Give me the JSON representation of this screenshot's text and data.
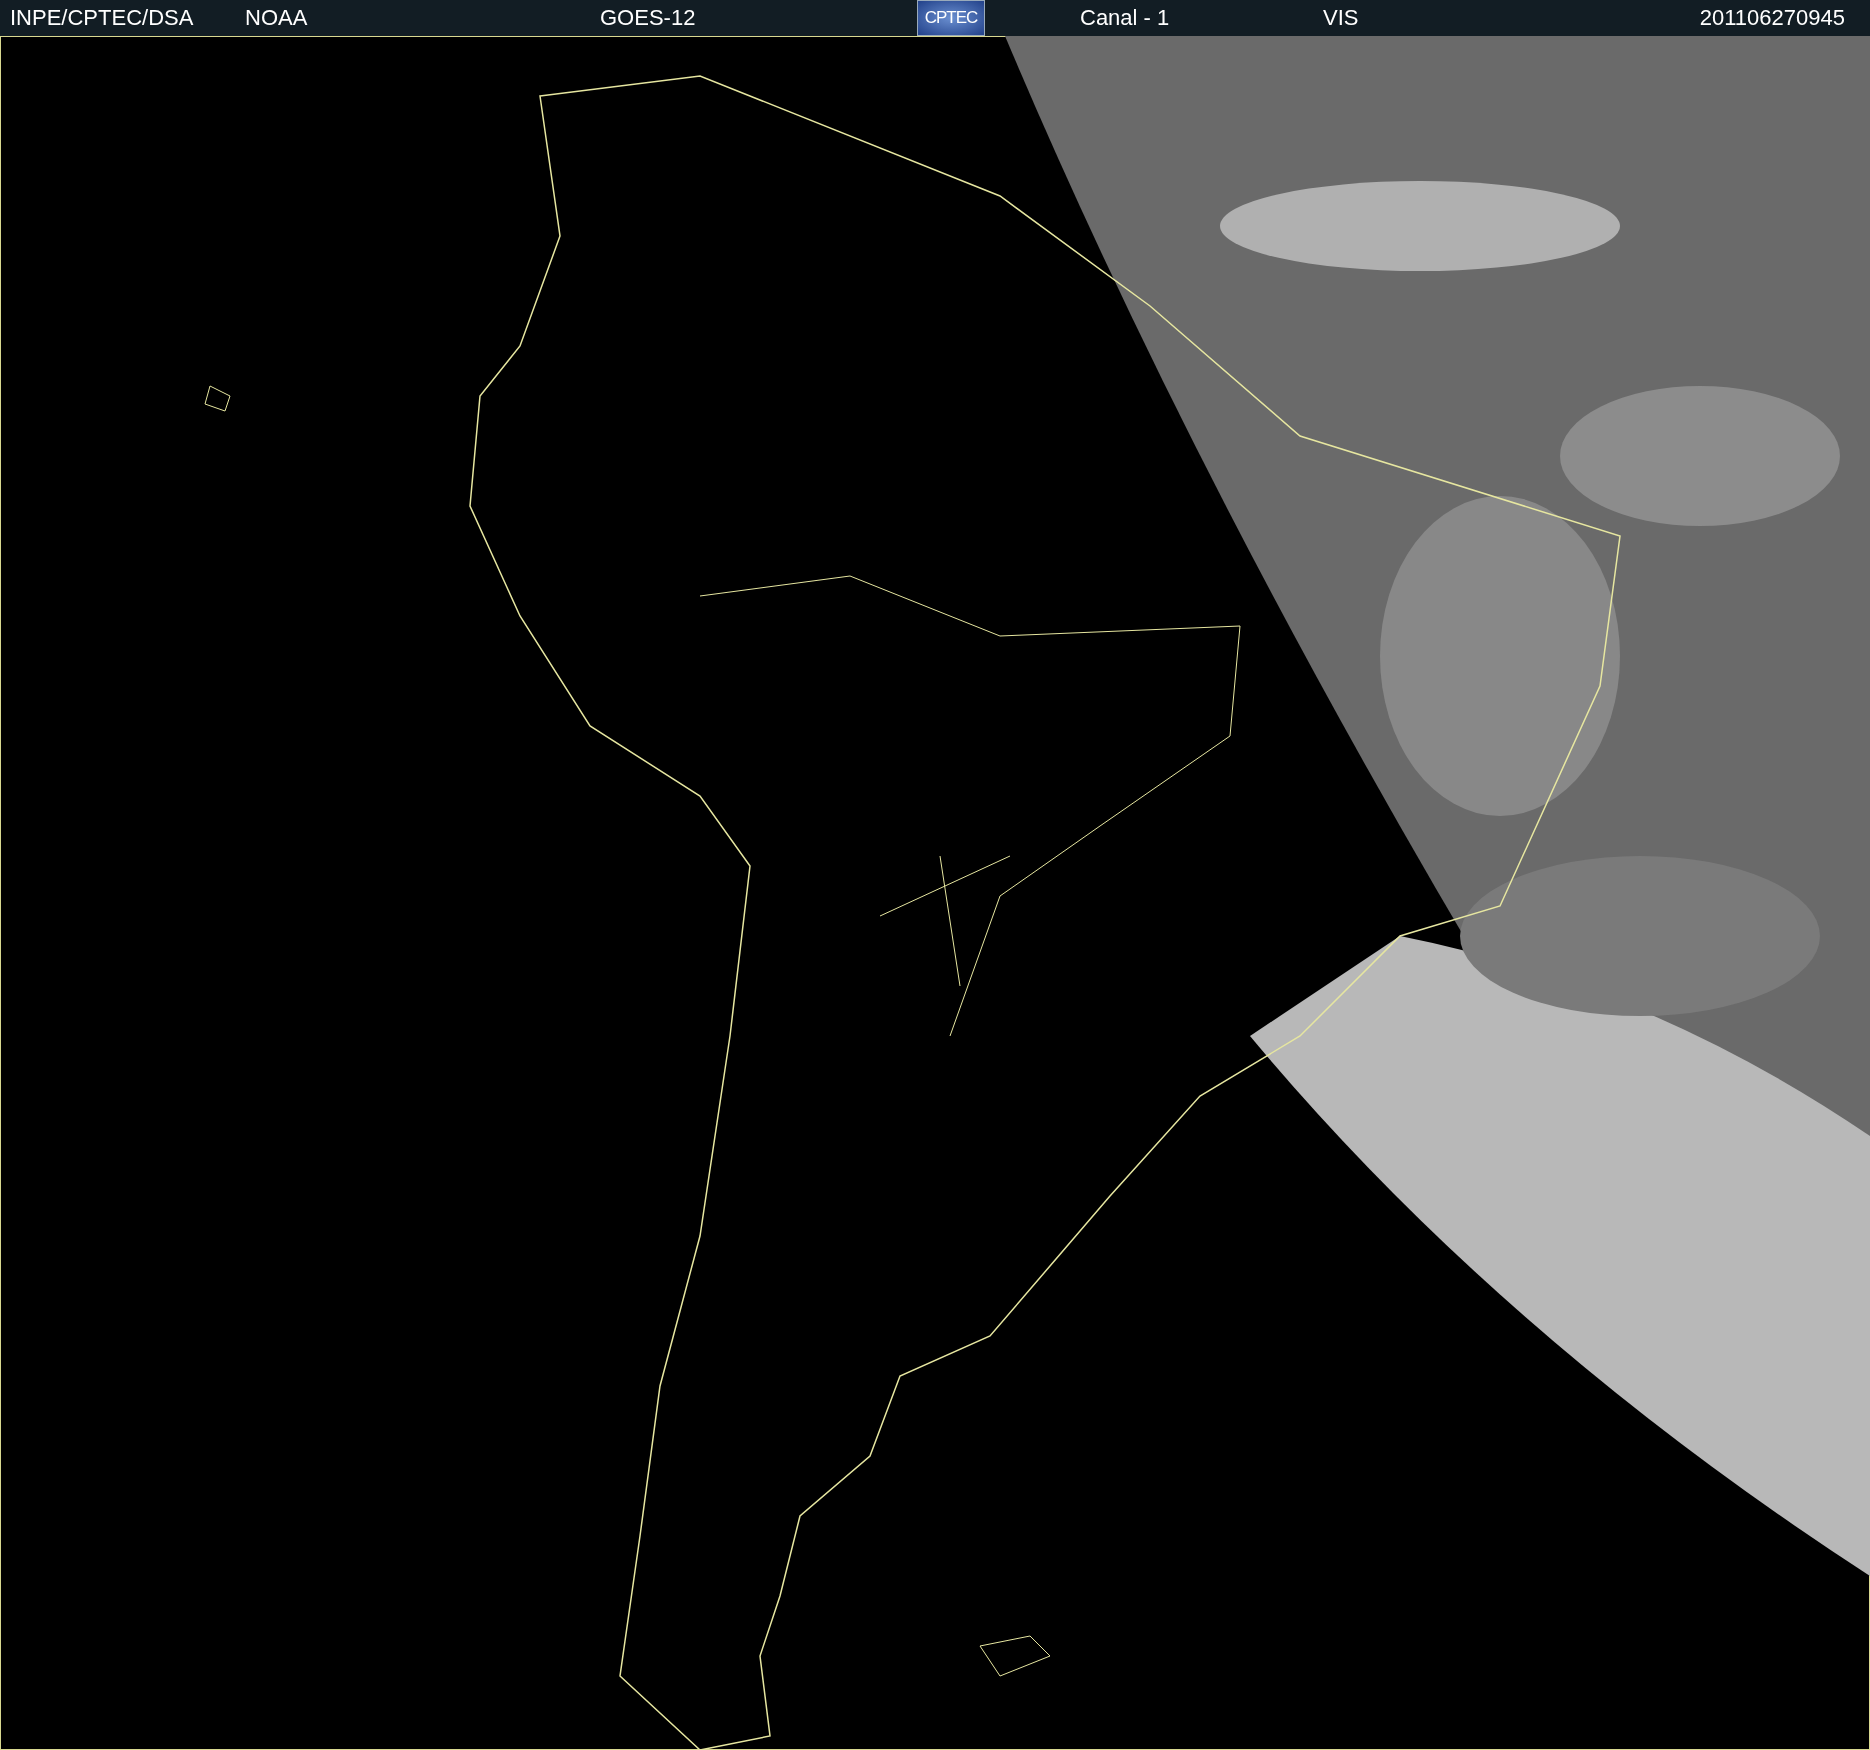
{
  "header": {
    "source": "INPE/CPTEC/DSA",
    "agency": "NOAA",
    "satellite": "GOES-12",
    "logo_text": "CPTEC",
    "channel": "Canal - 1",
    "band": "VIS",
    "timestamp": "201106270945"
  }
}
